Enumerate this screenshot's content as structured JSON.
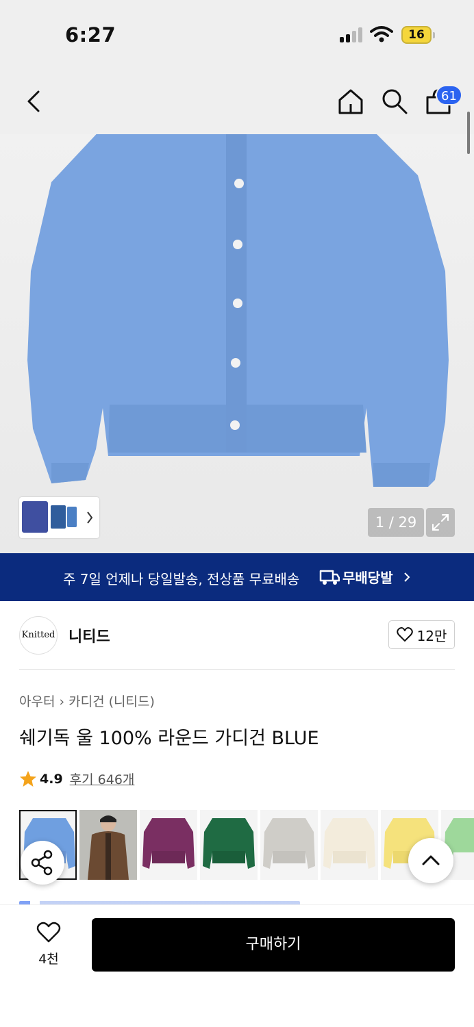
{
  "status_bar": {
    "time": "6:27",
    "battery": "16"
  },
  "nav": {
    "cart_count": "61"
  },
  "gallery": {
    "counter": "1 / 29"
  },
  "banner": {
    "text": "주 7일 언제나 당일발송, 전상품 무료배송",
    "service": "무배당발"
  },
  "brand": {
    "logo_text": "Knitted",
    "name": "니티드",
    "likes": "12만"
  },
  "breadcrumb": {
    "category": "아우터",
    "sub": "카디건 (니티드)"
  },
  "product": {
    "title": "쉐기독 울 100% 라운드 가디건 BLUE",
    "rating": "4.9",
    "reviews": "후기 646개"
  },
  "swatch_colors": [
    "#6f9fe0",
    "#6b4a32",
    "#7a2f62",
    "#1f6b43",
    "#cfcdc8",
    "#f3ecdc",
    "#f5e27c",
    "#9ed89b"
  ],
  "bottom": {
    "wish_count": "4천",
    "buy_label": "구매하기"
  },
  "colors": {
    "banner": "#0b2b7e",
    "badge": "#2b63f0",
    "sweater": "#7aa4e0"
  }
}
